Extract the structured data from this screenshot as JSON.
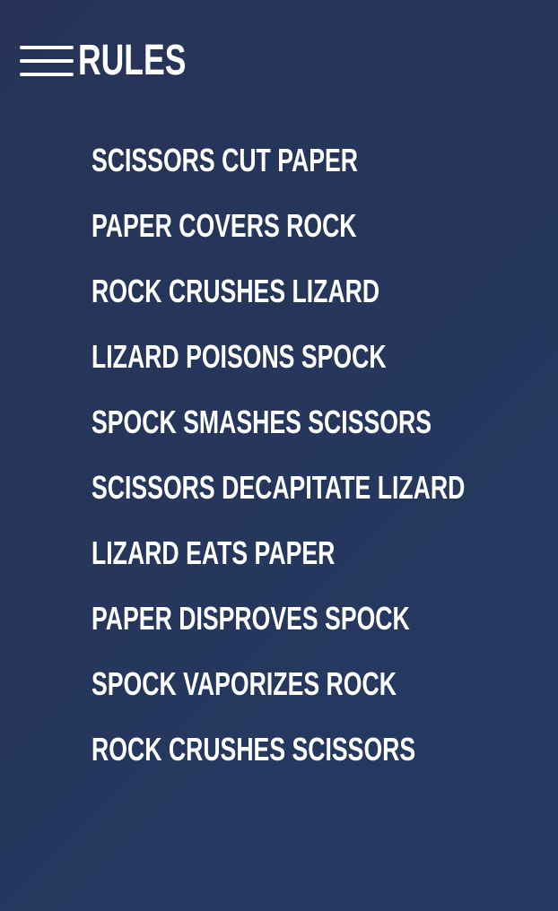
{
  "header": {
    "menu_icon": "hamburger-menu-icon",
    "title": "RULES"
  },
  "rules": [
    "SCISSORS CUT PAPER",
    "PAPER COVERS ROCK",
    "ROCK CRUSHES LIZARD",
    "LIZARD POISONS SPOCK",
    "SPOCK SMASHES SCISSORS",
    "SCISSORS DECAPITATE LIZARD",
    "LIZARD EATS PAPER",
    "PAPER DISPROVES SPOCK",
    "SPOCK VAPORIZES ROCK",
    "ROCK CRUSHES SCISSORS"
  ],
  "colors": {
    "background": "#263356",
    "text": "#ffffff"
  }
}
